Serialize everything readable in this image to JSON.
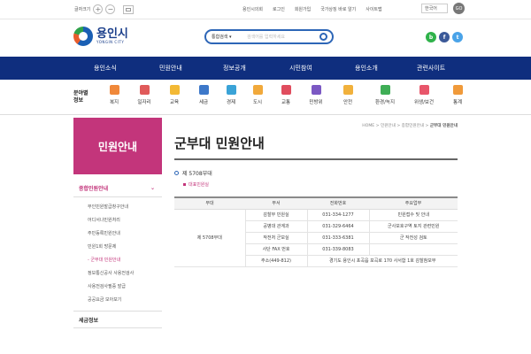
{
  "topbar": {
    "zoom_label": "글자크기",
    "zoom_in": "+",
    "zoom_out": "−",
    "links": [
      "용인시의회",
      "로그인",
      "회원가입",
      "국가상징 바로 알기",
      "사이트맵"
    ],
    "language": "한국어",
    "go": "GO"
  },
  "header": {
    "logo_text": "용인시",
    "logo_sub": "YONGIN CITY",
    "search_select": "통합검색 ▾",
    "search_placeholder": "검색어를 입력하세요"
  },
  "socials": [
    {
      "icon": "blog-icon",
      "label": "b",
      "color": "#2fb24a"
    },
    {
      "icon": "facebook-icon",
      "label": "f",
      "color": "#3b5998"
    },
    {
      "icon": "twitter-icon",
      "label": "t",
      "color": "#4aa3e8"
    }
  ],
  "gnb": [
    "용인소식",
    "민원안내",
    "정보공개",
    "시민참여",
    "용인소개",
    "관련사이트"
  ],
  "category": {
    "title_line1": "분야별",
    "title_line2": "정보",
    "items": [
      {
        "label": "복지",
        "icon": "welfare-icon",
        "color": "#f0883a"
      },
      {
        "label": "일자리",
        "icon": "jobs-icon",
        "color": "#e05a5a"
      },
      {
        "label": "교육",
        "icon": "education-icon",
        "color": "#f3b935"
      },
      {
        "label": "세금",
        "icon": "tax-icon",
        "color": "#3d78c9"
      },
      {
        "label": "경제",
        "icon": "economy-icon",
        "color": "#3aa3d7"
      },
      {
        "label": "도시",
        "icon": "city-icon",
        "color": "#f1a93b"
      },
      {
        "label": "교통",
        "icon": "traffic-icon",
        "color": "#e04d5e"
      },
      {
        "label": "민방위",
        "icon": "civil-defense-icon",
        "color": "#7b58c3"
      },
      {
        "label": "안전",
        "icon": "safety-icon",
        "color": "#f1b13c"
      },
      {
        "label": "환경/녹지",
        "icon": "environment-icon",
        "color": "#3fae56"
      },
      {
        "label": "위생/보건",
        "icon": "health-icon",
        "color": "#e8566b"
      },
      {
        "label": "통계",
        "icon": "statistics-icon",
        "color": "#f09a3a"
      }
    ]
  },
  "lnb": {
    "title": "민원안내",
    "section": "종합민원안내",
    "items": [
      {
        "label": "무인민원발급창구안내",
        "active": false
      },
      {
        "label": "어디서나민원처리",
        "active": false
      },
      {
        "label": "주민등록민원안내",
        "active": false
      },
      {
        "label": "민원1회 방문제",
        "active": false
      },
      {
        "label": "- 군부대 민원안내",
        "active": true
      },
      {
        "label": "정보통신공사 사용전검사",
        "active": false
      },
      {
        "label": "사용전검사필증 발급",
        "active": false
      },
      {
        "label": "공공요금 모아보기",
        "active": false
      }
    ],
    "next_section": "세금정보"
  },
  "content": {
    "breadcrumb": [
      "HOME",
      "민원안내",
      "종합민원안내"
    ],
    "breadcrumb_current": "군부대 민원안내",
    "title": "군부대 민원안내",
    "unit": "제 5708부대",
    "rep_link": "대표민원실",
    "table": {
      "headers": [
        "부대",
        "부서",
        "전화번호",
        "주요업무"
      ],
      "unit_cell": "제 5708부대",
      "rows": [
        [
          "감찰부 민원실",
          "031-334-1277",
          "민원접수 및 안내"
        ],
        [
          "공병대 관계과",
          "031-329-6464",
          "군사보호구역 토지 관련민원"
        ],
        [
          "작전처 군보실",
          "031-333-6381",
          "군 작전성 검토"
        ],
        [
          "사단 FAX 번호",
          "031-339-8083",
          ""
        ],
        [
          "주소(449-812)",
          "경기도 용인시 포곡읍 포곡로 170 사서함 1호 감찰참모부",
          ""
        ]
      ]
    }
  }
}
